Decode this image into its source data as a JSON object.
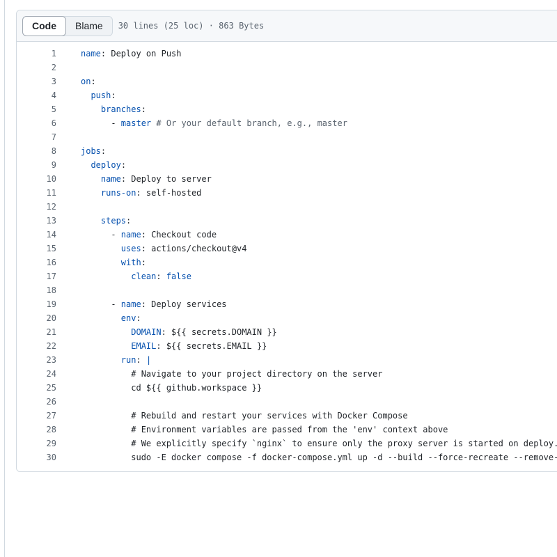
{
  "header": {
    "tabs": [
      "Code",
      "Blame"
    ],
    "active_tab": "Code",
    "meta": "30 lines (25 loc) · 863 Bytes"
  },
  "colors": {
    "key": "#0550ae",
    "comment": "#59636e",
    "text": "#1f2328",
    "line_number": "#59636e"
  },
  "code": [
    [
      [
        "k",
        "name"
      ],
      [
        "t",
        ": Deploy on Push"
      ]
    ],
    [],
    [
      [
        "k",
        "on"
      ],
      [
        "t",
        ":"
      ]
    ],
    [
      [
        "t",
        "  "
      ],
      [
        "k",
        "push"
      ],
      [
        "t",
        ":"
      ]
    ],
    [
      [
        "t",
        "    "
      ],
      [
        "k",
        "branches"
      ],
      [
        "t",
        ":"
      ]
    ],
    [
      [
        "t",
        "      - "
      ],
      [
        "k",
        "master"
      ],
      [
        "t",
        " "
      ],
      [
        "c",
        "# Or your default branch, e.g., master"
      ]
    ],
    [],
    [
      [
        "k",
        "jobs"
      ],
      [
        "t",
        ":"
      ]
    ],
    [
      [
        "t",
        "  "
      ],
      [
        "k",
        "deploy"
      ],
      [
        "t",
        ":"
      ]
    ],
    [
      [
        "t",
        "    "
      ],
      [
        "k",
        "name"
      ],
      [
        "t",
        ": Deploy to server"
      ]
    ],
    [
      [
        "t",
        "    "
      ],
      [
        "k",
        "runs-on"
      ],
      [
        "t",
        ": self-hosted"
      ]
    ],
    [],
    [
      [
        "t",
        "    "
      ],
      [
        "k",
        "steps"
      ],
      [
        "t",
        ":"
      ]
    ],
    [
      [
        "t",
        "      - "
      ],
      [
        "k",
        "name"
      ],
      [
        "t",
        ": Checkout code"
      ]
    ],
    [
      [
        "t",
        "        "
      ],
      [
        "k",
        "uses"
      ],
      [
        "t",
        ": actions/checkout@v4"
      ]
    ],
    [
      [
        "t",
        "        "
      ],
      [
        "k",
        "with"
      ],
      [
        "t",
        ":"
      ]
    ],
    [
      [
        "t",
        "          "
      ],
      [
        "k",
        "clean"
      ],
      [
        "t",
        ": "
      ],
      [
        "k",
        "false"
      ]
    ],
    [],
    [
      [
        "t",
        "      - "
      ],
      [
        "k",
        "name"
      ],
      [
        "t",
        ": Deploy services"
      ]
    ],
    [
      [
        "t",
        "        "
      ],
      [
        "k",
        "env"
      ],
      [
        "t",
        ":"
      ]
    ],
    [
      [
        "t",
        "          "
      ],
      [
        "k",
        "DOMAIN"
      ],
      [
        "t",
        ": ${{ secrets.DOMAIN }}"
      ]
    ],
    [
      [
        "t",
        "          "
      ],
      [
        "k",
        "EMAIL"
      ],
      [
        "t",
        ": ${{ secrets.EMAIL }}"
      ]
    ],
    [
      [
        "t",
        "        "
      ],
      [
        "k",
        "run"
      ],
      [
        "t",
        ": "
      ],
      [
        "k",
        "|"
      ]
    ],
    [
      [
        "t",
        "          # Navigate to your project directory on the server"
      ]
    ],
    [
      [
        "t",
        "          cd ${{ github.workspace }}"
      ]
    ],
    [],
    [
      [
        "t",
        "          # Rebuild and restart your services with Docker Compose"
      ]
    ],
    [
      [
        "t",
        "          # Environment variables are passed from the 'env' context above"
      ]
    ],
    [
      [
        "t",
        "          # We explicitly specify `nginx` to ensure only the proxy server is started on deploy."
      ]
    ],
    [
      [
        "t",
        "          sudo -E docker compose -f docker-compose.yml up -d --build --force-recreate --remove-"
      ]
    ]
  ]
}
